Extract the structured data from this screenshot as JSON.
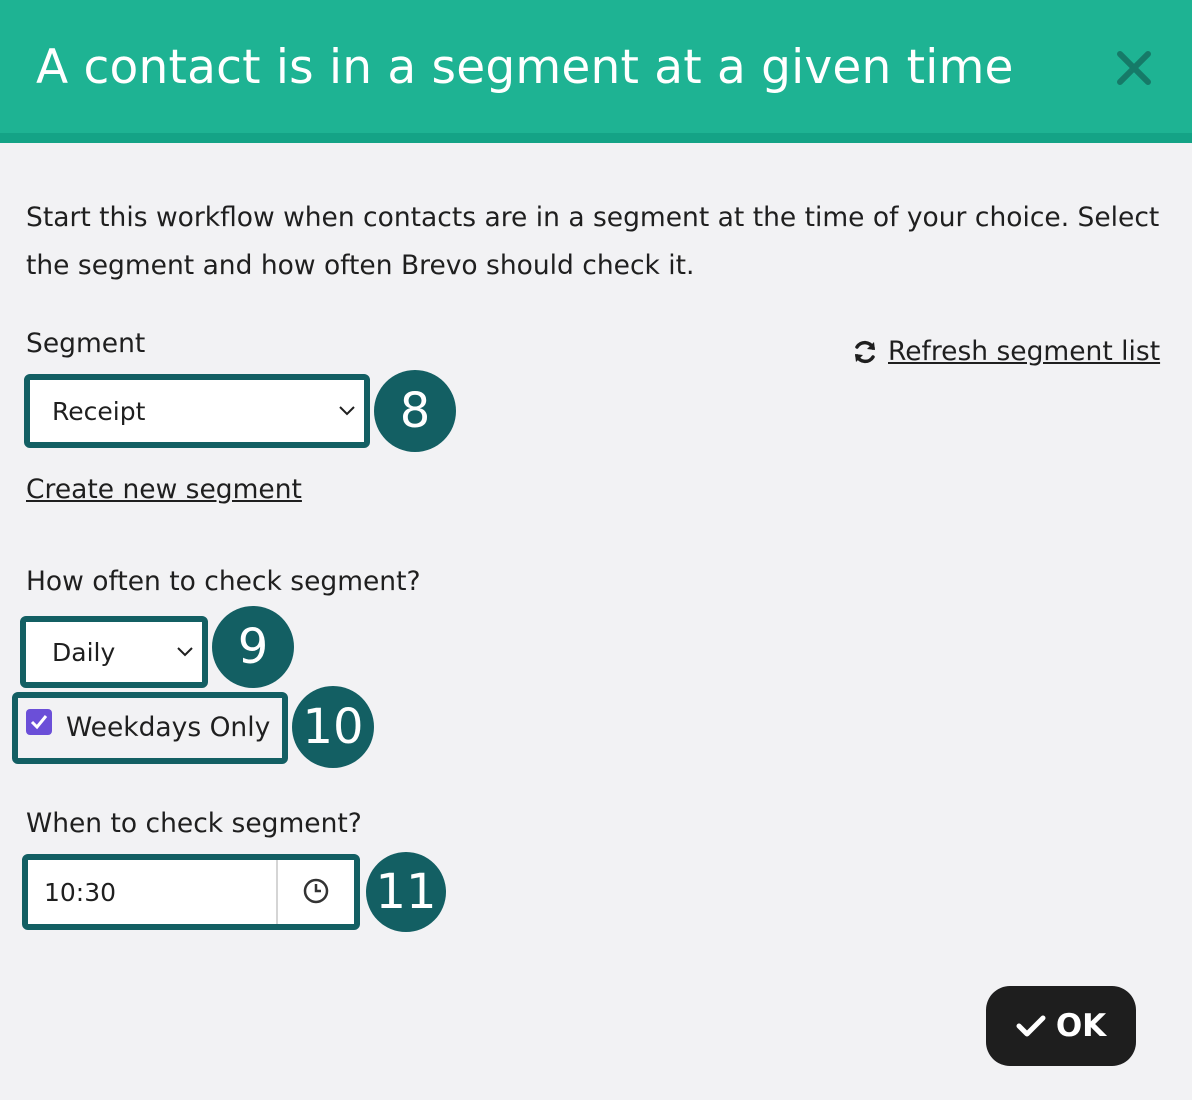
{
  "dialog": {
    "title": "A contact is in a segment at a given time",
    "description": "Start this workflow when contacts are in a segment at the time of your choice. Select the segment and how often Brevo should check it."
  },
  "segment": {
    "label": "Segment",
    "selected": "Receipt",
    "refresh_label": " Refresh segment list",
    "create_label": "Create new segment",
    "badge": "8"
  },
  "frequency": {
    "label": "How often to check segment?",
    "selected": "Daily",
    "badge": "9",
    "weekdays_label": "Weekdays Only",
    "weekdays_checked": true,
    "weekdays_badge": "10"
  },
  "time": {
    "label": "When to check segment?",
    "value": "10:30",
    "badge": "11"
  },
  "ok_label": "OK",
  "icons": [
    "close-icon",
    "refresh-icon",
    "chevron-down-icon",
    "check-icon",
    "clock-icon"
  ],
  "colors": {
    "header": "#1eb393",
    "annotation": "#135f63",
    "checkbox": "#6b4fd8",
    "ok_button": "#1e1e1e"
  }
}
